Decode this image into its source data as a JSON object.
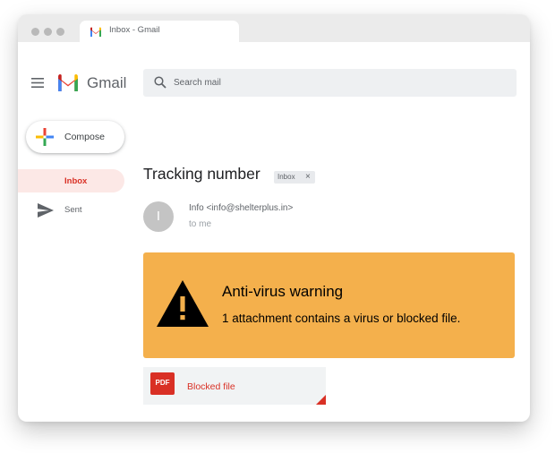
{
  "browser": {
    "tab_title": "Inbox - Gmail"
  },
  "header": {
    "logo_text": "Gmail",
    "search": {
      "placeholder": "Search mail",
      "value": ""
    }
  },
  "sidebar": {
    "compose_label": "Compose",
    "items": [
      {
        "label": "Inbox",
        "active": true,
        "icon": "inbox"
      },
      {
        "label": "Sent",
        "active": false,
        "icon": "send-icon"
      }
    ]
  },
  "email": {
    "subject": "Tracking number",
    "label_chip": "Inbox",
    "chip_close": "×",
    "avatar_letter": "I",
    "sender": "Info <info@shelterplus.in>",
    "recipient": "to me"
  },
  "warning": {
    "title": "Anti-virus warning",
    "message": "1 attachment contains a virus or blocked file.",
    "color": "#f4b04c",
    "icon": "warning-triangle-icon"
  },
  "attachment": {
    "type_badge": "PDF",
    "name": "Blocked file",
    "badge_color": "#d93025"
  },
  "colors": {
    "accent_red": "#d93025",
    "inbox_active_bg": "#fce8e6",
    "search_bg": "#eef0f2"
  }
}
